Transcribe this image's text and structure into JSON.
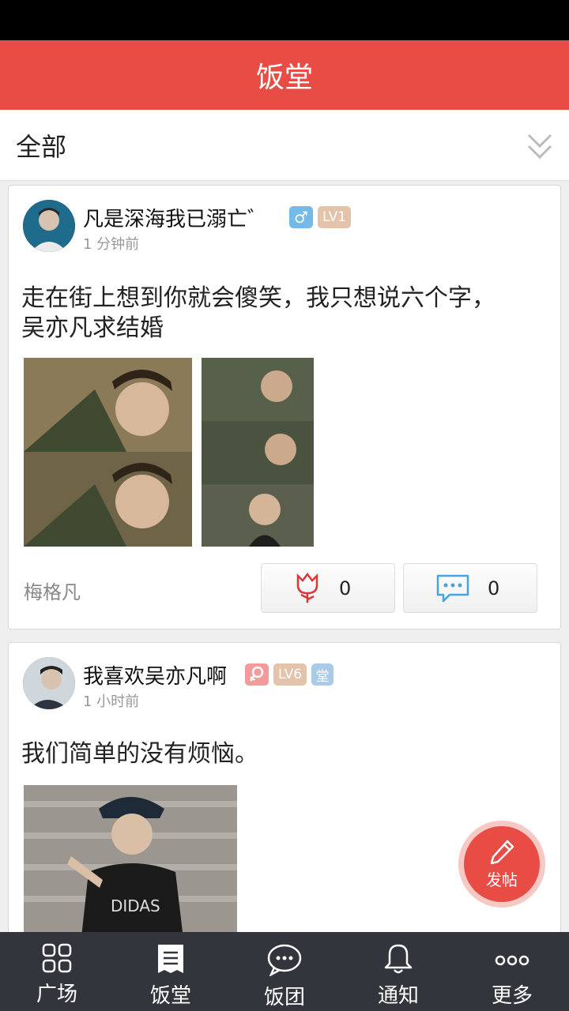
{
  "header": {
    "title": "饭堂"
  },
  "filter": {
    "label": "全部"
  },
  "posts": [
    {
      "username": "凡是深海我已溺亡゛",
      "time": "1 分钟前",
      "level": "LV1",
      "gender_icon": "male-icon",
      "content": "走在街上想到你就会傻笑，我只想说六个字，吴亦凡求结婚",
      "author_tag": "梅格凡",
      "likes": "0",
      "comments": "0"
    },
    {
      "username": "我喜欢吴亦凡啊",
      "time": "1 小时前",
      "level": "LV6",
      "gender_icon": "female-icon",
      "extra_badge": "堂",
      "content": "我们简单的没有烦恼。"
    }
  ],
  "fab": {
    "label": "发帖"
  },
  "tabs": [
    {
      "label": "广场",
      "icon": "grid-icon"
    },
    {
      "label": "饭堂",
      "icon": "document-icon"
    },
    {
      "label": "饭团",
      "icon": "chat-bubble-icon"
    },
    {
      "label": "通知",
      "icon": "bell-icon"
    },
    {
      "label": "更多",
      "icon": "more-icon"
    }
  ],
  "colors": {
    "brand": "#e84c44",
    "tab_bar": "#32363c",
    "male": "#74b9e8",
    "female": "#f39a9a",
    "level": "#e3c3a9"
  }
}
